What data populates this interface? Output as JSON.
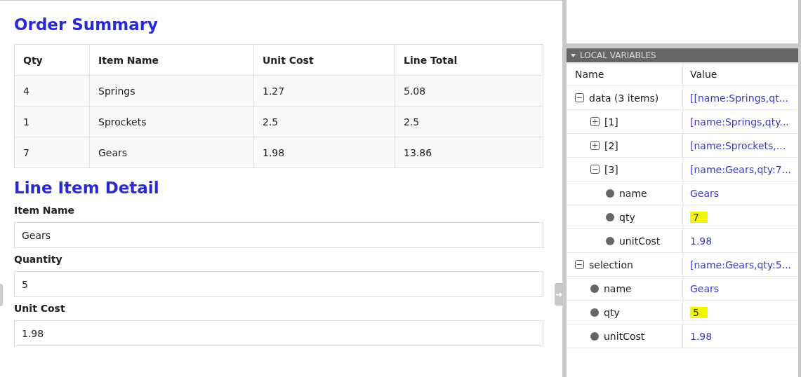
{
  "order_summary": {
    "title": "Order Summary",
    "columns": [
      "Qty",
      "Item Name",
      "Unit Cost",
      "Line Total"
    ],
    "rows": [
      [
        "4",
        "Springs",
        "1.27",
        "5.08"
      ],
      [
        "1",
        "Sprockets",
        "2.5",
        "2.5"
      ],
      [
        "7",
        "Gears",
        "1.98",
        "13.86"
      ]
    ]
  },
  "line_item_detail": {
    "title": "Line Item Detail",
    "fields": [
      {
        "label": "Item Name",
        "value": "Gears"
      },
      {
        "label": "Quantity",
        "value": "5"
      },
      {
        "label": "Unit Cost",
        "value": "1.98"
      }
    ]
  },
  "local_variables": {
    "title": "LOCAL VARIABLES",
    "expanded": true,
    "columns": [
      "Name",
      "Value"
    ],
    "tree": [
      {
        "kind": "node",
        "name": "data (3 items)",
        "value": "[[name:Springs,qt...",
        "expanded": true,
        "highlighted": false,
        "children": [
          {
            "kind": "node",
            "name": "[1]",
            "value": "[name:Springs,qty...",
            "expanded": false,
            "highlighted": false
          },
          {
            "kind": "node",
            "name": "[2]",
            "value": "[name:Sprockets,...",
            "expanded": false,
            "highlighted": false
          },
          {
            "kind": "node",
            "name": "[3]",
            "value": "[name:Gears,qty:7...",
            "expanded": true,
            "highlighted": false,
            "children": [
              {
                "kind": "leaf",
                "name": "name",
                "value": "Gears",
                "highlighted": false
              },
              {
                "kind": "leaf",
                "name": "qty",
                "value": "7",
                "highlighted": true
              },
              {
                "kind": "leaf",
                "name": "unitCost",
                "value": "1.98",
                "highlighted": false
              }
            ]
          }
        ]
      },
      {
        "kind": "node",
        "name": "selection",
        "value": "[name:Gears,qty:5...",
        "expanded": true,
        "highlighted": false,
        "children": [
          {
            "kind": "leaf",
            "name": "name",
            "value": "Gears",
            "highlighted": false
          },
          {
            "kind": "leaf",
            "name": "qty",
            "value": "5",
            "highlighted": true
          },
          {
            "kind": "leaf",
            "name": "unitCost",
            "value": "1.98",
            "highlighted": false
          }
        ]
      }
    ]
  }
}
